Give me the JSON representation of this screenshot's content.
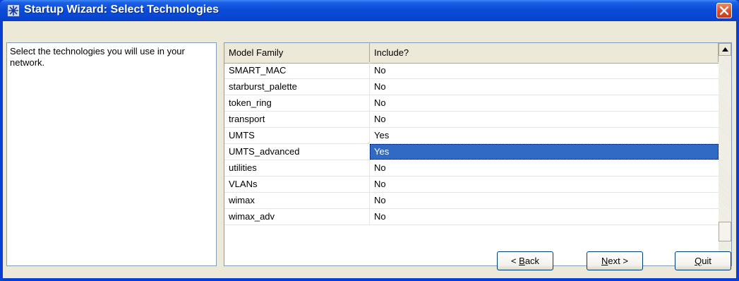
{
  "window": {
    "title": "Startup Wizard: Select Technologies"
  },
  "description": "Select the technologies you will use in your network.",
  "grid": {
    "columns": [
      "Model Family",
      "Include?"
    ],
    "rows": [
      {
        "family": "SMART_MAC",
        "include": "No"
      },
      {
        "family": "starburst_palette",
        "include": "No"
      },
      {
        "family": "token_ring",
        "include": "No"
      },
      {
        "family": "transport",
        "include": "No"
      },
      {
        "family": "UMTS",
        "include": "Yes"
      },
      {
        "family": "UMTS_advanced",
        "include": "Yes",
        "selected": true
      },
      {
        "family": "utilities",
        "include": "No"
      },
      {
        "family": "VLANs",
        "include": "No"
      },
      {
        "family": "wimax",
        "include": "No"
      },
      {
        "family": "wimax_adv",
        "include": "No"
      }
    ]
  },
  "buttons": {
    "back": {
      "prefix": "< ",
      "mnemonic": "B",
      "rest": "ack"
    },
    "next": {
      "prefix": "",
      "mnemonic": "N",
      "rest": "ext >"
    },
    "quit": {
      "prefix": "",
      "mnemonic": "Q",
      "rest": "uit"
    }
  },
  "icons": {
    "title": "star-icon",
    "close": "close-icon",
    "scroll_up": "arrow-up-icon",
    "scroll_down": "arrow-down-icon"
  },
  "colors": {
    "titlebar": "#0a4bd8",
    "selection": "#316ac5",
    "close": "#e0502a",
    "dialog": "#ece9d8"
  }
}
